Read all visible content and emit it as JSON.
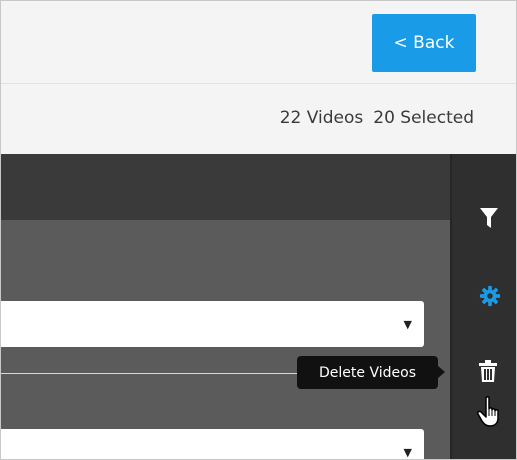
{
  "header": {
    "back_label": "< Back"
  },
  "summary": {
    "videos_count": "22 Videos",
    "selected_count": "20 Selected"
  },
  "sidebar": {
    "icons": [
      "filter-icon",
      "gear-icon",
      "trash-icon"
    ],
    "accent": "#1a9be8"
  },
  "tooltip": {
    "text": "Delete Videos"
  },
  "colors": {
    "primary_button": "#1a9be8",
    "panel_header": "#3a3a3a",
    "panel_body": "#5b5b5b",
    "sidebar": "#2f2f2f"
  }
}
